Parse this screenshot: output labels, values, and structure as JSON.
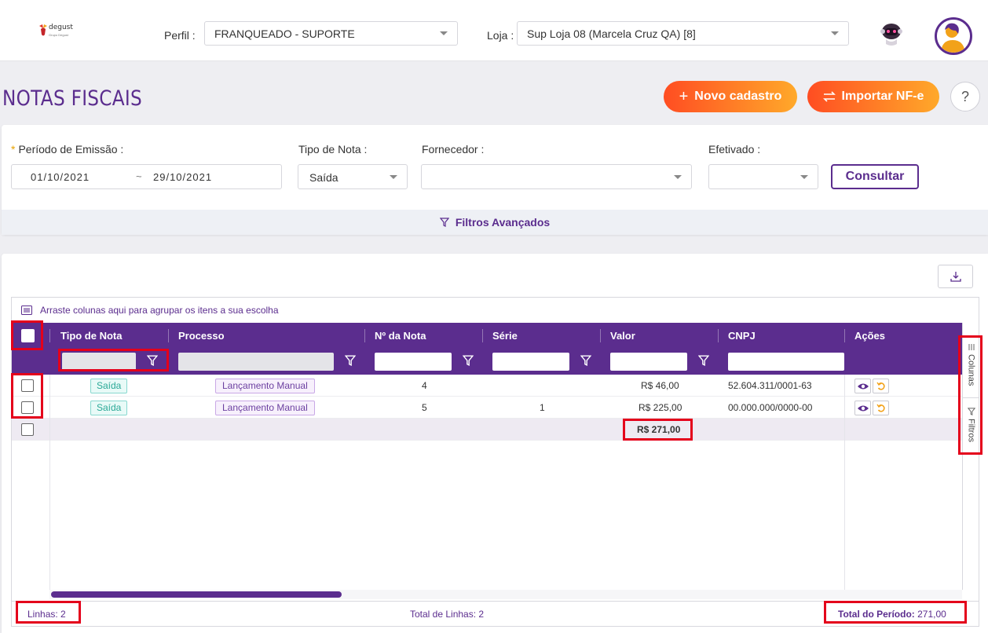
{
  "header": {
    "logo_text": "degust",
    "logo_sub": "Grupo Degust",
    "perfil_label": "Perfil :",
    "perfil_value": "FRANQUEADO - SUPORTE",
    "loja_label": "Loja :",
    "loja_value": "Sup Loja 08 (Marcela Cruz QA) [8]"
  },
  "page": {
    "title": "NOTAS FISCAIS",
    "novo_cadastro": "Novo cadastro",
    "importar_nfe": "Importar NF-e",
    "help": "?"
  },
  "filters": {
    "periodo_label": "Período de Emissão",
    "date_start": "01/10/2021",
    "date_sep": "~",
    "date_end": "29/10/2021",
    "tipo_label": "Tipo de Nota",
    "tipo_value": "Saída",
    "fornecedor_label": "Fornecedor",
    "fornecedor_value": "",
    "efetivado_label": "Efetivado",
    "efetivado_value": "",
    "consultar": "Consultar",
    "avancados": "Filtros Avançados"
  },
  "grid": {
    "group_hint": "Arraste colunas aqui para agrupar os itens a sua escolha",
    "columns": [
      "Tipo de Nota",
      "Processo",
      "Nº da Nota",
      "Série",
      "Valor",
      "CNPJ",
      "Ações"
    ],
    "rows": [
      {
        "tipo": "Saída",
        "processo": "Lançamento Manual",
        "numero": "4",
        "serie": "",
        "valor": "R$ 46,00",
        "cnpj": "52.604.311/0001-63"
      },
      {
        "tipo": "Saída",
        "processo": "Lançamento Manual",
        "numero": "5",
        "serie": "1",
        "valor": "R$ 225,00",
        "cnpj": "00.000.000/0000-00"
      }
    ],
    "total_valor": "R$ 271,00",
    "side_colunas": "Colunas",
    "side_filtros": "Filtros"
  },
  "footer": {
    "linhas": "Linhas: 2",
    "total_linhas": "Total de Linhas: 2",
    "total_periodo_label": "Total do Período:",
    "total_periodo_value": "271,00"
  },
  "colors": {
    "brand": "#5b2d8e",
    "accent_start": "#ff4d22",
    "accent_end": "#ffa92a",
    "highlight": "#e4001b"
  }
}
